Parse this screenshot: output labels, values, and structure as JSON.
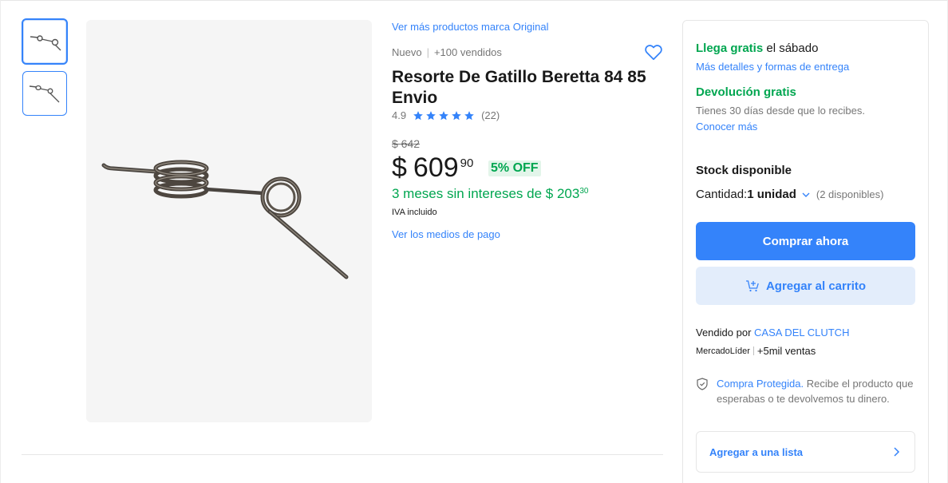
{
  "product": {
    "brand_link": "Ver más productos marca Original",
    "condition": "Nuevo",
    "sold": "+100 vendidos",
    "title": "Resorte De Gatillo Beretta 84 85 Envio",
    "rating": "4.9",
    "reviews": "(22)",
    "stars": 5,
    "old_price": "$ 642",
    "currency": "$",
    "price": "609",
    "cents": "90",
    "discount": "5% OFF",
    "installments_text": "3 meses sin intereses de $ 203",
    "installments_cents": "30",
    "tax_note": "IVA incluido",
    "payment_link": "Ver los medios de pago"
  },
  "shipping": {
    "free_label": "Llega gratis",
    "day": " el sábado",
    "details_link": "Más detalles y formas de entrega",
    "returns_label": "Devolución gratis",
    "returns_text": "Tienes 30 días desde que lo recibes.",
    "returns_link": "Conocer más"
  },
  "stock": {
    "label": "Stock disponible",
    "qty_label": "Cantidad: ",
    "qty_value": "1 unidad",
    "available": "(2 disponibles)"
  },
  "actions": {
    "buy_now": "Comprar ahora",
    "add_to_cart": "Agregar al carrito",
    "add_to_list": "Agregar a una lista"
  },
  "seller": {
    "sold_by": "Vendido por ",
    "name": "CASA DEL CLUTCH",
    "badge": "MercadoLíder",
    "sales": "+5mil ventas"
  },
  "protection": {
    "link": "Compra Protegida.",
    "text": " Recibe el producto que esperabas o te devolvemos tu dinero."
  },
  "colors": {
    "accent": "#3483fa",
    "green": "#00a650"
  }
}
